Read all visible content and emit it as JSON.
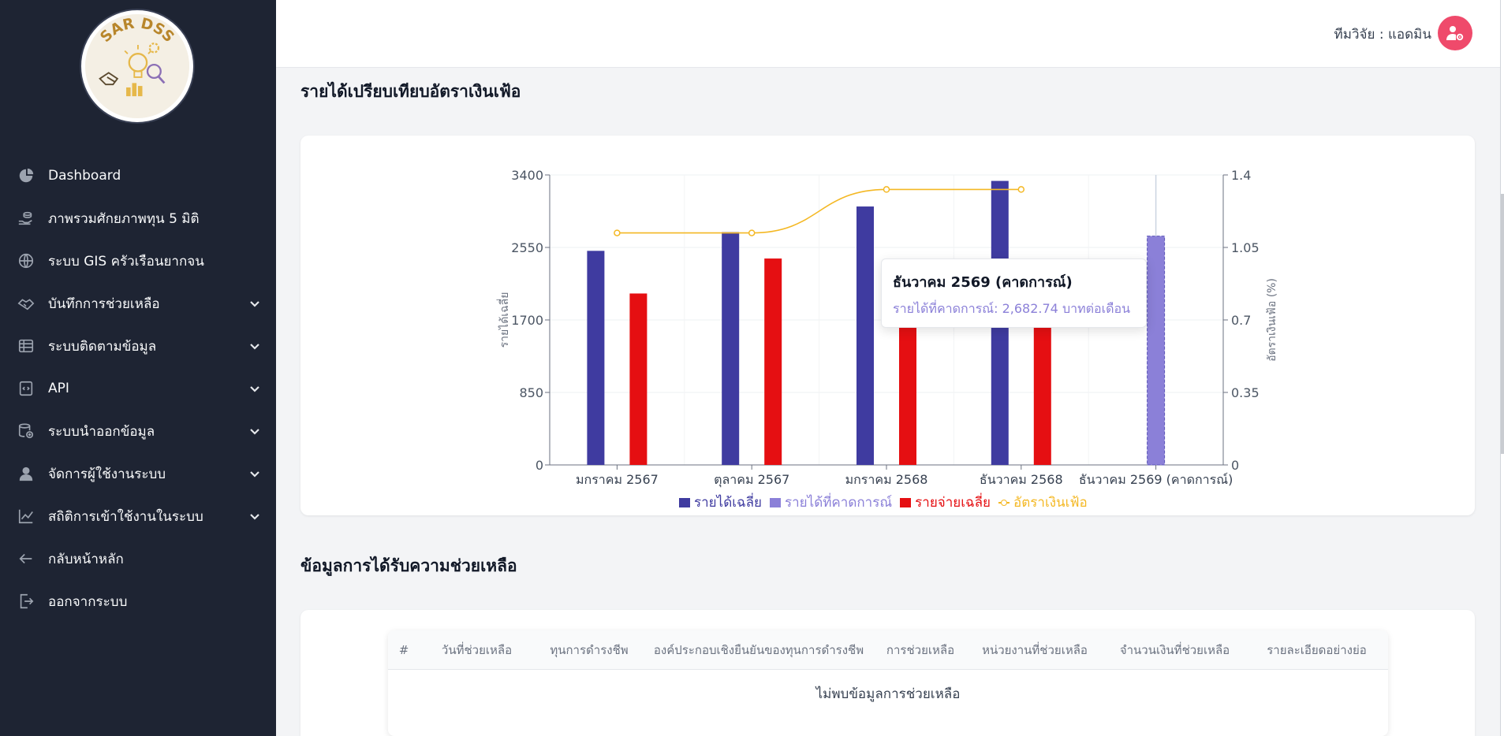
{
  "sidebar": {
    "logo_text": "SAR DSS",
    "items": [
      {
        "label": "Dashboard",
        "icon": "chart-pie-icon",
        "expandable": false
      },
      {
        "label": "ภาพรวมศักยภาพทุน 5 มิติ",
        "icon": "hand-coins-icon",
        "expandable": false
      },
      {
        "label": "ระบบ GIS ครัวเรือนยากจน",
        "icon": "globe-icon",
        "expandable": false
      },
      {
        "label": "บันทึกการช่วยเหลือ",
        "icon": "handshake-icon",
        "expandable": true
      },
      {
        "label": "ระบบติดตามข้อมูล",
        "icon": "table-list-icon",
        "expandable": true
      },
      {
        "label": "API",
        "icon": "code-file-icon",
        "expandable": true
      },
      {
        "label": "ระบบนำออกข้อมูล",
        "icon": "database-export-icon",
        "expandable": true
      },
      {
        "label": "จัดการผู้ใช้งานระบบ",
        "icon": "user-icon",
        "expandable": true
      },
      {
        "label": "สถิติการเข้าใช้งานในระบบ",
        "icon": "line-chart-icon",
        "expandable": true
      },
      {
        "label": "กลับหน้าหลัก",
        "icon": "arrow-left-icon",
        "expandable": false
      },
      {
        "label": "ออกจากระบบ",
        "icon": "logout-icon",
        "expandable": false
      }
    ]
  },
  "header": {
    "user_label": "ทีมวิจัย : แอดมิน",
    "avatar_icon": "user-gear-icon",
    "avatar_color": "#ef4a6b"
  },
  "income_section": {
    "title": "รายได้เปรียบเทียบอัตราเงินเฟ้อ"
  },
  "chart_data": {
    "type": "bar",
    "categories": [
      "มกราคม 2567",
      "ตุลาคม 2567",
      "มกราคม 2568",
      "ธันวาคม 2568",
      "ธันวาคม 2569 (คาดการณ์)"
    ],
    "ylabel": "รายได้เฉลี่ย",
    "y2label": "อัตราเงินเฟ้อ (%)",
    "ylim": [
      0,
      3400
    ],
    "y2lim": [
      0,
      1.4
    ],
    "yticks": [
      "0",
      "850",
      "1700",
      "2550",
      "3400"
    ],
    "y2ticks": [
      "0",
      "0.35",
      "0.7",
      "1.05",
      "1.4"
    ],
    "grid": true,
    "legend_position": "bottom",
    "series": [
      {
        "name": "รายได้เฉลี่ย",
        "type": "bar",
        "axis": "left",
        "color": "#3f3ba0",
        "values": [
          2510,
          2730,
          3030,
          3330,
          null
        ]
      },
      {
        "name": "รายได้ที่คาดการณ์",
        "type": "bar",
        "axis": "left",
        "color": "#8b80d8",
        "values": [
          null,
          null,
          null,
          null,
          2682.74
        ]
      },
      {
        "name": "รายจ่ายเฉลี่ย",
        "type": "bar",
        "axis": "left",
        "color": "#e50f12",
        "values": [
          2010,
          2420,
          1900,
          1880,
          null
        ]
      },
      {
        "name": "อัตราเงินเฟ้อ",
        "type": "line",
        "axis": "right",
        "color": "#f4b824",
        "values": [
          1.12,
          1.12,
          1.33,
          1.33,
          null
        ]
      }
    ],
    "tooltip": {
      "title": "ธันวาคม 2569 (คาดการณ์)",
      "line": "รายได้ที่คาดการณ์: 2,682.74 บาทต่อเดือน"
    }
  },
  "assistance_section": {
    "title": "ข้อมูลการได้รับความช่วยเหลือ",
    "columns": [
      "#",
      "วันที่ช่วยเหลือ",
      "ทุนการดำรงชีพ",
      "องค์ประกอบเชิงยืนยันของทุนการดำรงชีพ",
      "การช่วยเหลือ",
      "หน่วยงานที่ช่วยเหลือ",
      "จำนวนเงินที่ช่วยเหลือ",
      "รายละเอียดอย่างย่อ"
    ],
    "empty_message": "ไม่พบข้อมูลการช่วยเหลือ"
  }
}
